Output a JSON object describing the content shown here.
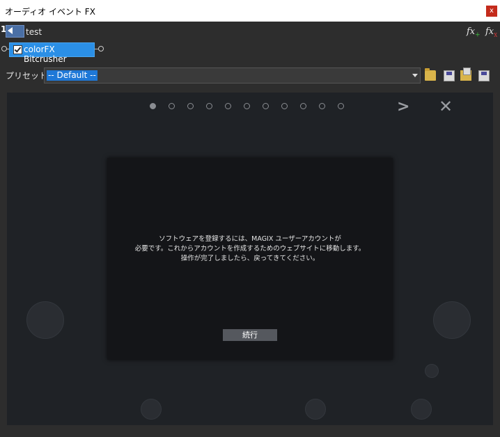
{
  "window": {
    "title": "オーディオ イベント FX",
    "close_label": "x"
  },
  "chain": {
    "track_number": "1",
    "track_name": "test",
    "plugin_name": "colorFX Bitcrusher",
    "plugin_enabled": true,
    "add_fx_label": "fx",
    "remove_fx_label": "fx"
  },
  "preset": {
    "label": "プリセット:",
    "selected": "-- Default --"
  },
  "plugin_panel": {
    "page_count": 11,
    "active_page": 1,
    "next_label": ">",
    "close_label": "✕"
  },
  "dialog": {
    "message_lines": [
      "ソフトウェアを登録するには、MAGIX ユーザーアカウントが",
      "必要です。これからアカウントを作成するためのウェブサイトに移動します。",
      "操作が完了しましたら、戻ってきてください。"
    ],
    "continue_label": "続行"
  },
  "icons": {
    "preset_open": "folder-icon",
    "preset_save": "save-icon",
    "preset_save_as": "save-as-icon",
    "preset_save_all": "save-all-icon"
  },
  "colors": {
    "accent": "#2b8fe6",
    "selection": "#1e78d7",
    "panel_bg": "#1f2226",
    "dialog_bg": "#141518"
  }
}
